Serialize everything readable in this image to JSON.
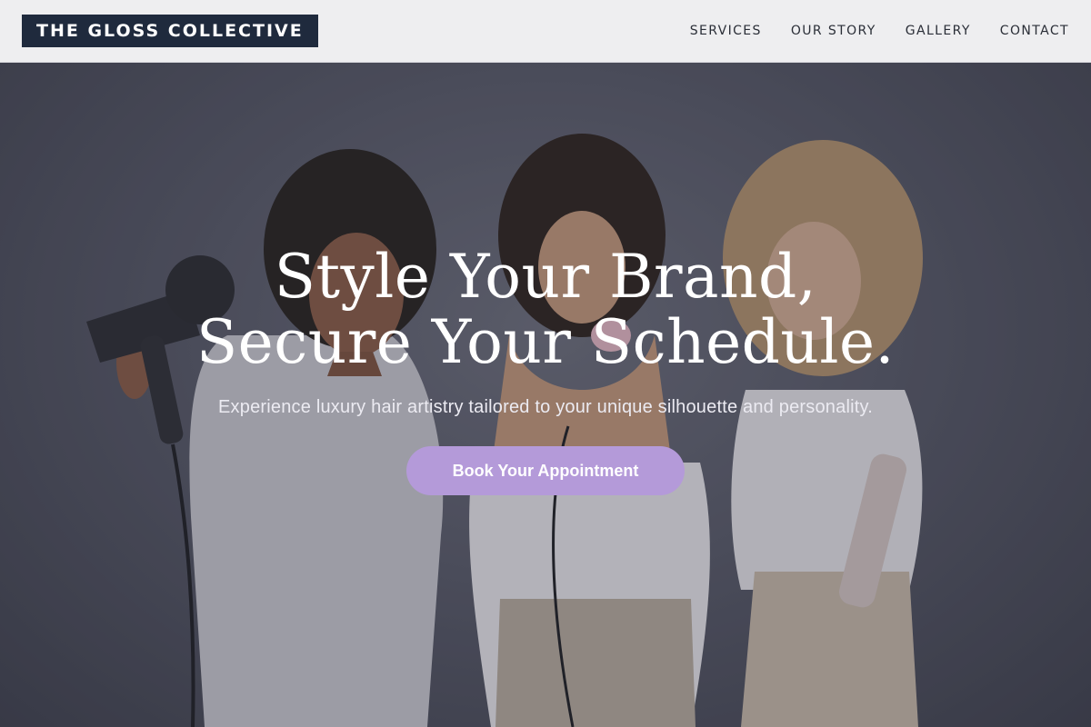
{
  "brand": {
    "name": "THE GLOSS COLLECTIVE"
  },
  "nav": {
    "items": [
      {
        "label": "SERVICES"
      },
      {
        "label": "OUR STORY"
      },
      {
        "label": "GALLERY"
      },
      {
        "label": "CONTACT"
      }
    ]
  },
  "hero": {
    "headline_line1": "Style Your Brand,",
    "headline_line2": "Secure Your Schedule.",
    "subtitle": "Experience luxury hair artistry tailored to your unique silhouette and personality.",
    "cta_label": "Book Your Appointment",
    "image_icon": "salon-models-photo"
  },
  "colors": {
    "brand_bg": "#1f2a3d",
    "nav_bg": "#eeeef0",
    "cta_bg": "#b49ad9",
    "headline": "#ffffff"
  }
}
